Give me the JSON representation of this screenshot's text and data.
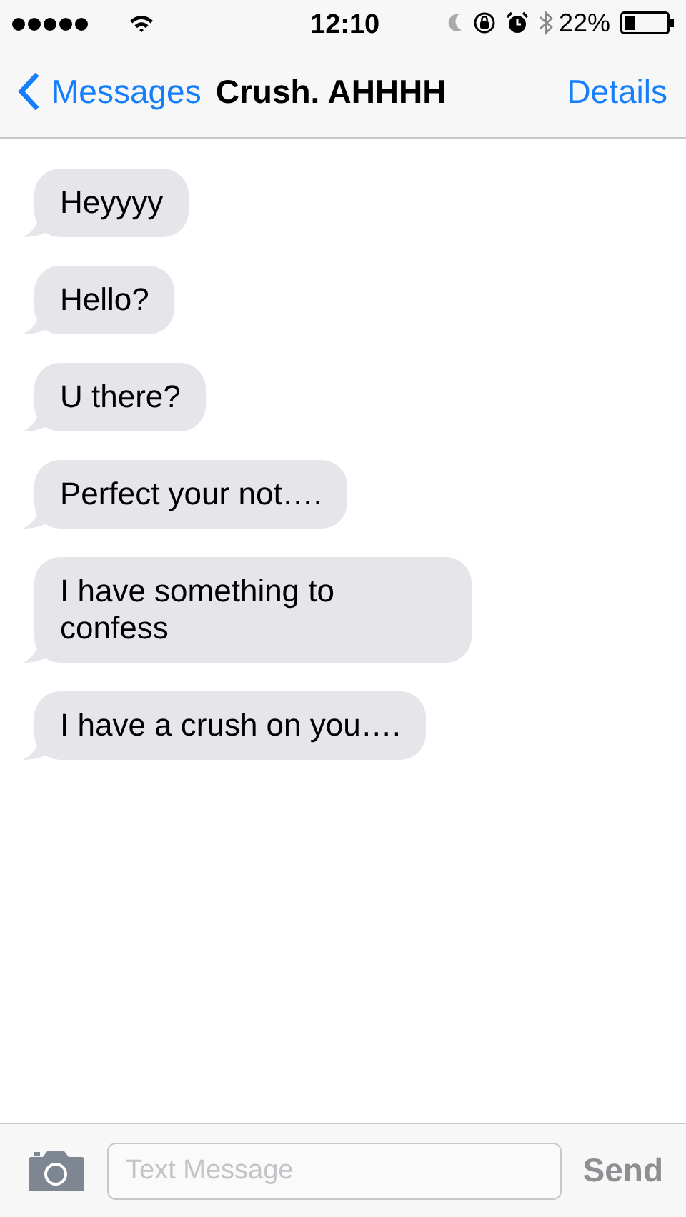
{
  "status_bar": {
    "time": "12:10",
    "battery": "22%"
  },
  "nav_bar": {
    "back": "Messages",
    "title": "Crush. AHHHH",
    "action": "Details"
  },
  "messages": [
    {
      "text": "Heyyyy"
    },
    {
      "text": "Hello?"
    },
    {
      "text": "U there?"
    },
    {
      "text": "Perfect your not…."
    },
    {
      "text": "I have something to confess"
    },
    {
      "text": "I have a crush on you…."
    }
  ],
  "composer": {
    "placeholder": "Text Message",
    "send": "Send"
  }
}
